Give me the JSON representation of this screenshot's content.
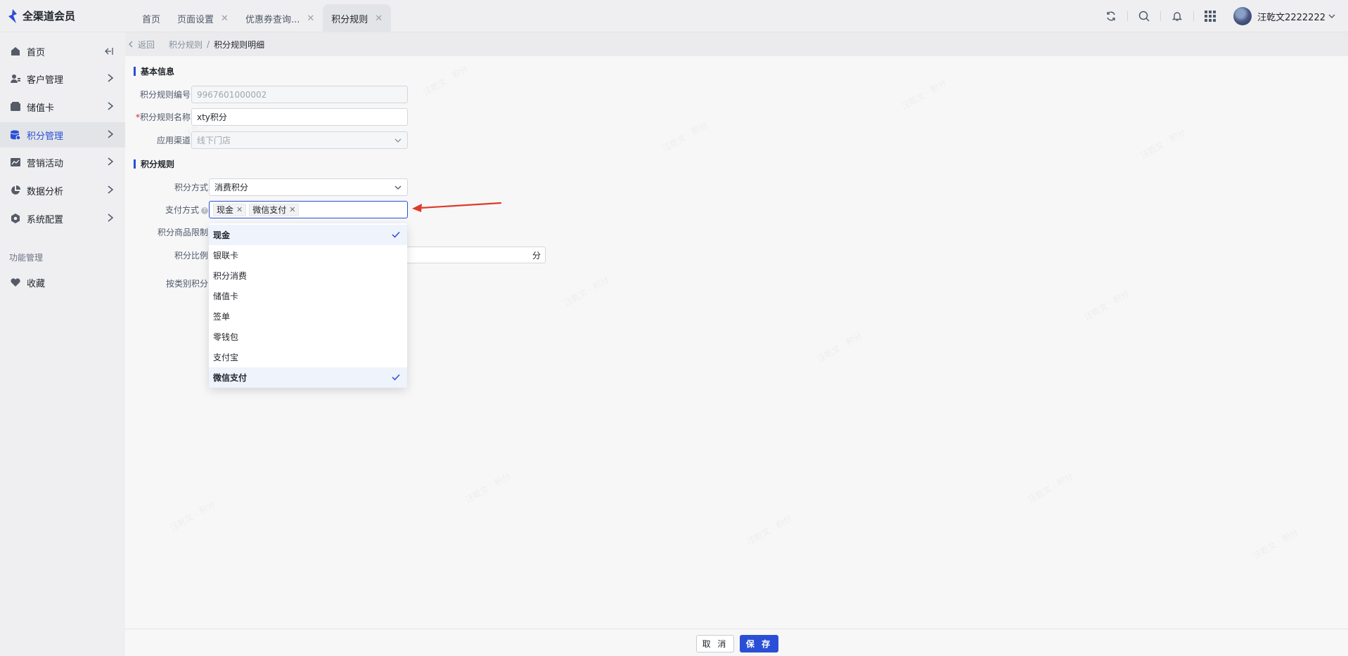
{
  "app": {
    "title": "全渠道会员"
  },
  "tabs": [
    {
      "label": "首页",
      "closable": false
    },
    {
      "label": "页面设置",
      "closable": true
    },
    {
      "label": "优惠券查询...",
      "closable": true
    },
    {
      "label": "积分规则",
      "closable": true,
      "active": true
    }
  ],
  "user": {
    "name": "汪乾文2222222"
  },
  "sidebar": {
    "items": [
      {
        "label": "首页",
        "icon": "home-icon"
      },
      {
        "label": "客户管理",
        "icon": "users-icon"
      },
      {
        "label": "储值卡",
        "icon": "card-icon"
      },
      {
        "label": "积分管理",
        "icon": "points-icon",
        "active": true
      },
      {
        "label": "营销活动",
        "icon": "chart-icon"
      },
      {
        "label": "数据分析",
        "icon": "pie-icon"
      },
      {
        "label": "系统配置",
        "icon": "settings-icon"
      }
    ],
    "group_title": "功能管理",
    "favorites": {
      "label": "收藏",
      "icon": "heart-icon"
    }
  },
  "breadcrumb": {
    "back": "返回",
    "parent": "积分规则",
    "sep": "/",
    "current": "积分规则明细"
  },
  "basic": {
    "title": "基本信息",
    "code_label": "积分规则编号",
    "code_value": "9967601000002",
    "name_label": "积分规则名称",
    "name_required": "*",
    "name_value": "xty积分",
    "channel_label": "应用渠道",
    "channel_value": "线下门店"
  },
  "rules": {
    "title": "积分规则",
    "method_label": "积分方式",
    "method_value": "消费积分",
    "pay_label": "支付方式",
    "pay_help": "?",
    "pay_tags": [
      "现金",
      "微信支付"
    ],
    "goods_limit_label": "积分商品限制",
    "ratio_label": "积分比例",
    "ratio_suffix": "分",
    "category_label": "按类别积分"
  },
  "dropdown": {
    "options": [
      {
        "label": "现金",
        "selected": true
      },
      {
        "label": "银联卡",
        "selected": false
      },
      {
        "label": "积分消费",
        "selected": false
      },
      {
        "label": "储值卡",
        "selected": false
      },
      {
        "label": "签单",
        "selected": false
      },
      {
        "label": "零钱包",
        "selected": false
      },
      {
        "label": "支付宝",
        "selected": false
      },
      {
        "label": "微信支付",
        "selected": true
      }
    ]
  },
  "footer": {
    "cancel": "取 消",
    "save": "保 存"
  },
  "colors": {
    "primary": "#2a4fd6",
    "annotation": "#e03a2a"
  }
}
